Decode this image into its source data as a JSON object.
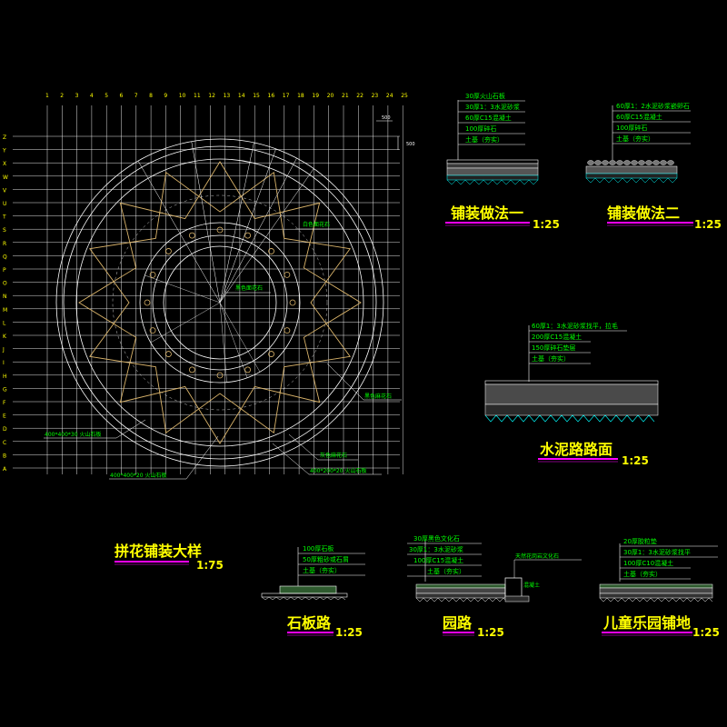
{
  "plan": {
    "title": "拼花铺装大样",
    "scale": "1:75",
    "col_labels": [
      "1",
      "2",
      "3",
      "4",
      "5",
      "6",
      "7",
      "8",
      "9",
      "10",
      "11",
      "12",
      "13",
      "14",
      "15",
      "16",
      "17",
      "18",
      "19",
      "20",
      "21",
      "22",
      "23",
      "24",
      "25"
    ],
    "row_labels": [
      "Z",
      "Y",
      "X",
      "W",
      "V",
      "U",
      "T",
      "S",
      "R",
      "Q",
      "P",
      "O",
      "N",
      "M",
      "L",
      "K",
      "J",
      "I",
      "H",
      "G",
      "F",
      "E",
      "D",
      "C",
      "B",
      "A"
    ],
    "dim_500": "500",
    "callouts": {
      "white_stone": "白色面花石",
      "center_stone": "黑色面花石",
      "dark_stone": "黑色麻花石",
      "grey_stone": "灰色麻花石",
      "tile_a": "400*400*30 火山石板",
      "tile_b": "400*400*20 火山石板",
      "tile_c": "400*200*20 火山石板"
    }
  },
  "sections": {
    "paving1": {
      "title": "铺装做法一",
      "scale": "1:25",
      "layers": [
        "30厚火山石板",
        "30厚1：3水泥砂浆",
        "60厚C15混凝土",
        "100厚碎石",
        "土基（夯实）"
      ]
    },
    "paving2": {
      "title": "铺装做法二",
      "scale": "1:25",
      "layers": [
        "60厚1：2水泥砂浆嵌卵石",
        "60厚C15混凝土",
        "100厚碎石",
        "土基（夯实）"
      ]
    },
    "cement": {
      "title": "水泥路路面",
      "scale": "1:25",
      "layers": [
        "60厚1：3水泥砂浆找平，拉毛",
        "200厚C15混凝土",
        "150厚碎石垫层",
        "土基（夯实）"
      ]
    },
    "slab": {
      "title": "石板路",
      "scale": "1:25",
      "layers": [
        "100厚石板",
        "50厚粗砂或石屑",
        "土基（夯实）"
      ]
    },
    "garden": {
      "title": "园路",
      "scale": "1:25",
      "layers": [
        "30厚黑色文化石",
        "30厚1：3水泥砂浆",
        "100厚C15混凝土",
        "土基（夯实）"
      ],
      "curb_note": "天然花岗岩文化石",
      "curb_note2": "混凝土"
    },
    "kids": {
      "title": "儿童乐园铺地",
      "scale": "1:25",
      "layers": [
        "20厚胶粒垫",
        "30厚1：3水泥砂浆找平",
        "100厚C10混凝土",
        "土基（夯实）"
      ]
    }
  },
  "colors": {
    "grid": "#ffffff",
    "linework": "#ffff00",
    "underline": "#ff00ff",
    "labels": "#00ff00",
    "background": "#000000"
  }
}
